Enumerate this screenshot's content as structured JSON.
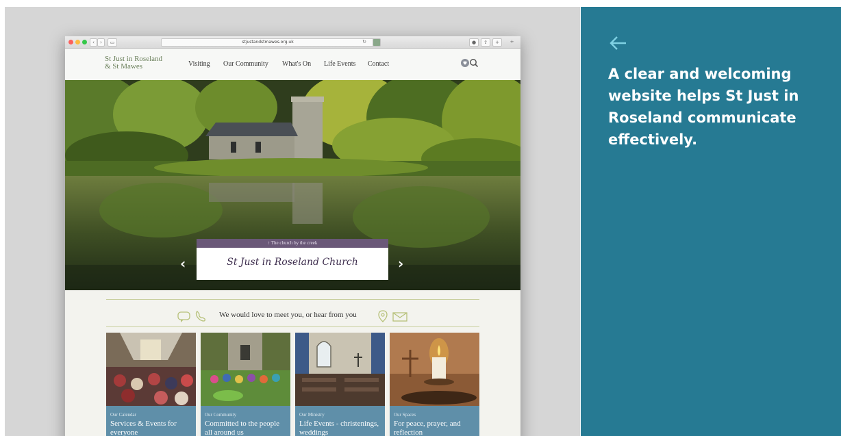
{
  "side_panel": {
    "back_icon": "arrow-left-icon",
    "text": "A clear and welcoming website helps St Just in Roseland communicate effectively.",
    "bg_color": "#267a93"
  },
  "browser": {
    "url": "stjustandstmawes.org.uk"
  },
  "site": {
    "brand_line1": "St Just in Roseland",
    "brand_line2": "& St Mawes",
    "nav": [
      "Visiting",
      "Our Community",
      "What's On",
      "Life Events",
      "Contact"
    ],
    "nav_icons": [
      "heart-icon",
      "search-icon"
    ]
  },
  "hero": {
    "caption_kicker": "↑ The church by the creek",
    "caption_title": "St Just in Roseland Church",
    "prev_icon": "chevron-left-icon",
    "next_icon": "chevron-right-icon"
  },
  "contact_strip": {
    "text": "We would love to meet you, or hear from you",
    "icons": [
      "speech-bubble-icon",
      "phone-icon",
      "location-pin-icon",
      "envelope-icon"
    ]
  },
  "cards": [
    {
      "kicker": "Our Calendar",
      "title": "Services & Events for everyone"
    },
    {
      "kicker": "Our Community",
      "title": "Committed to the people all around us"
    },
    {
      "kicker": "Our Ministry",
      "title": "Life Events - christenings, weddings"
    },
    {
      "kicker": "Our Spaces",
      "title": "For peace, prayer, and reflection"
    }
  ]
}
